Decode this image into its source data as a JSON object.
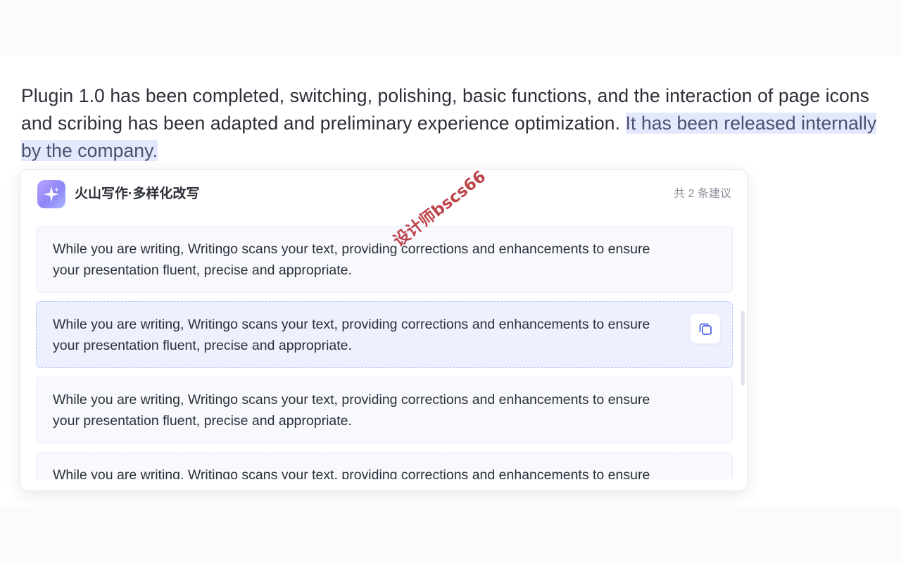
{
  "document": {
    "paragraph_text": "Plugin 1.0 has been completed, switching, polishing, basic functions, and the interaction of page icons and scribing has been adapted and preliminary experience optimization. ",
    "selected_text": "It has been released internally by the company."
  },
  "panel": {
    "logo_icon": "sparkle-icon",
    "title": "火山写作·多样化改写",
    "count": "共 2 条建议",
    "suggestions": [
      {
        "text": "While you are writing, Writingo scans your text, providing corrections and enhancements to ensure your presentation fluent, precise and appropriate."
      },
      {
        "text": "While you are writing, Writingo scans your text, providing corrections and enhancements to ensure your presentation fluent, precise and appropriate."
      },
      {
        "text": "While you are writing, Writingo scans your text, providing corrections and enhancements to ensure your presentation fluent, precise and appropriate."
      },
      {
        "text": "While you are writing, Writingo scans your text, providing corrections and enhancements to ensure your presentation fluent, precise and appropriate."
      }
    ],
    "copy_icon": "copy-icon"
  },
  "watermark": "设计师bscs66",
  "colors": {
    "selection_highlight": "#e3e8fd",
    "active_card": "#edf0ff",
    "logo_gradient_start": "#b9a4ff",
    "logo_gradient_end": "#8d86f7"
  }
}
